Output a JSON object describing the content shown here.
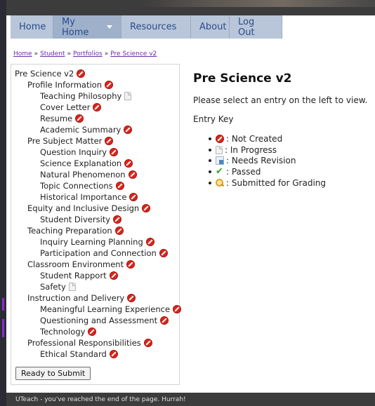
{
  "nav": {
    "items": [
      {
        "label": "Home"
      },
      {
        "label": "My Home"
      },
      {
        "label": "Resources"
      },
      {
        "label": "About"
      },
      {
        "label": "Log Out"
      }
    ]
  },
  "breadcrumb": {
    "items": [
      "Home",
      "Student",
      "Portfolios",
      "Pre Science v2"
    ],
    "separator": "»"
  },
  "tree": {
    "root": "Pre Science v2",
    "nodes": [
      {
        "label": "Profile Information",
        "status": "not-created"
      },
      {
        "label": "Teaching Philosophy",
        "status": "in-progress"
      },
      {
        "label": "Cover Letter",
        "status": "not-created"
      },
      {
        "label": "Resume",
        "status": "not-created"
      },
      {
        "label": "Academic Summary",
        "status": "not-created"
      },
      {
        "label": "Pre Subject Matter",
        "status": "not-created"
      },
      {
        "label": "Question Inquiry",
        "status": "not-created"
      },
      {
        "label": "Science Explanation",
        "status": "not-created"
      },
      {
        "label": "Natural Phenomenon",
        "status": "not-created"
      },
      {
        "label": "Topic Connections",
        "status": "not-created"
      },
      {
        "label": "Historical Importance",
        "status": "not-created"
      },
      {
        "label": "Equity and Inclusive Design",
        "status": "not-created"
      },
      {
        "label": "Student Diversity",
        "status": "not-created"
      },
      {
        "label": "Teaching Preparation",
        "status": "not-created"
      },
      {
        "label": "Inquiry Learning Planning",
        "status": "not-created"
      },
      {
        "label": "Participation and Connection",
        "status": "not-created"
      },
      {
        "label": "Classroom Environment",
        "status": "not-created"
      },
      {
        "label": "Student Rapport",
        "status": "not-created"
      },
      {
        "label": "Safety",
        "status": "in-progress"
      },
      {
        "label": "Instruction and Delivery",
        "status": "not-created"
      },
      {
        "label": "Meaningful Learning Experience",
        "status": "not-created"
      },
      {
        "label": "Questioning and Assessment",
        "status": "not-created"
      },
      {
        "label": "Technology",
        "status": "not-created"
      },
      {
        "label": "Professional Responsibilities",
        "status": "not-created"
      },
      {
        "label": "Ethical Standard",
        "status": "not-created"
      }
    ]
  },
  "submit_label": "Ready to Submit",
  "main": {
    "title": "Pre Science v2",
    "message": "Please select an entry on the left to view.",
    "key_title": "Entry Key",
    "key": [
      {
        "icon": "not-created-icon",
        "label": ": Not Created"
      },
      {
        "icon": "in-progress-icon",
        "label": ": In Progress"
      },
      {
        "icon": "needs-revision-icon",
        "label": ": Needs Revision"
      },
      {
        "icon": "passed-icon",
        "label": ": Passed"
      },
      {
        "icon": "submitted-icon",
        "label": ": Submitted for Grading"
      }
    ]
  },
  "footer": {
    "text": "UTeach - you've reached the end of the page. Hurrah!"
  },
  "colors": {
    "nav_bg": "#b9c6d9",
    "nav_text": "#2a4c8c",
    "topbar": "#3c3c3c",
    "not_created": "#d9261c",
    "link": "#6a2cab"
  }
}
